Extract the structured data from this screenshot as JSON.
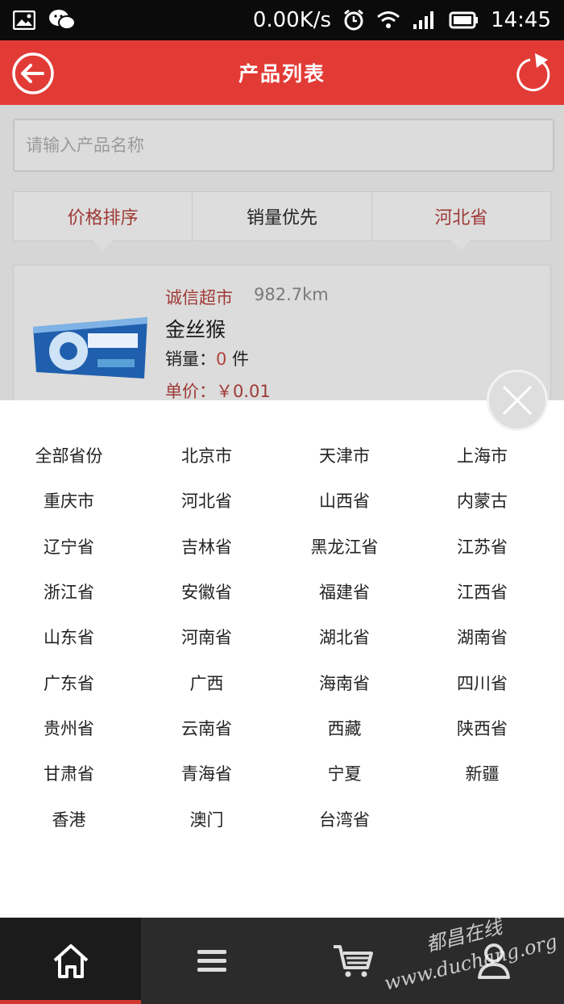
{
  "status_bar": {
    "network_speed": "0.00K/s",
    "time": "14:45",
    "icons": [
      "image-icon",
      "wechat-icon",
      "alarm-icon",
      "wifi-icon",
      "signal-icon",
      "battery-icon"
    ]
  },
  "header": {
    "title": "产品列表",
    "color": "#e23b36"
  },
  "search": {
    "placeholder": "请输入产品名称"
  },
  "sort_tabs": [
    {
      "label": "价格排序"
    },
    {
      "label": "销量优先"
    },
    {
      "label": "河北省"
    }
  ],
  "product": {
    "store": "诚信超市",
    "distance": "982.7km",
    "name": "金丝猴",
    "sales_label": "销量：",
    "sales_count": "0",
    "sales_unit": " 件",
    "price": "单价：￥0.01"
  },
  "provinces": [
    "全部省份",
    "北京市",
    "天津市",
    "上海市",
    "重庆市",
    "河北省",
    "山西省",
    "内蒙古",
    "辽宁省",
    "吉林省",
    "黑龙江省",
    "江苏省",
    "浙江省",
    "安徽省",
    "福建省",
    "江西省",
    "山东省",
    "河南省",
    "湖北省",
    "湖南省",
    "广东省",
    "广西",
    "海南省",
    "四川省",
    "贵州省",
    "云南省",
    "西藏",
    "陕西省",
    "甘肃省",
    "青海省",
    "宁夏",
    "新疆",
    "香港",
    "澳门",
    "台湾省"
  ],
  "bottom_nav": [
    "home-icon",
    "menu-icon",
    "cart-icon",
    "user-icon"
  ],
  "watermark": {
    "line1": "都昌在线",
    "line2": "www.duchang.org"
  }
}
